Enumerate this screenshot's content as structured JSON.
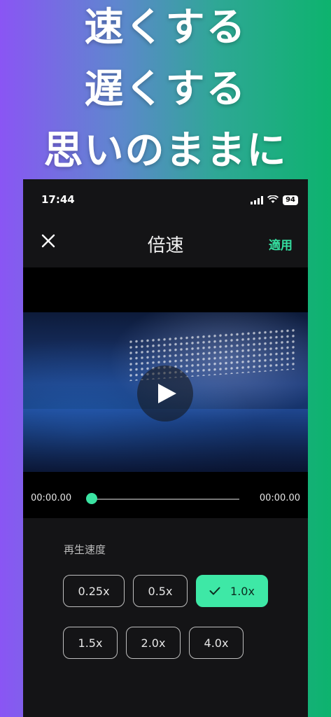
{
  "promo": {
    "line1": "速くする",
    "line2": "遅くする",
    "line3": "思いのままに"
  },
  "status_bar": {
    "time": "17:44",
    "battery": "94"
  },
  "nav": {
    "title": "倍速",
    "apply_label": "適用",
    "close_icon": "close-icon"
  },
  "player": {
    "current_time": "00:00.00",
    "total_time": "00:00.00",
    "progress": 0
  },
  "speed": {
    "label": "再生速度",
    "selected": "1.0x",
    "options_row1": [
      "0.25x",
      "0.5x",
      "1.0x"
    ],
    "options_row2": [
      "1.5x",
      "2.0x",
      "4.0x"
    ]
  },
  "colors": {
    "accent": "#3ee8a6",
    "apply_text": "#35e0a1",
    "panel_bg": "#141416"
  }
}
